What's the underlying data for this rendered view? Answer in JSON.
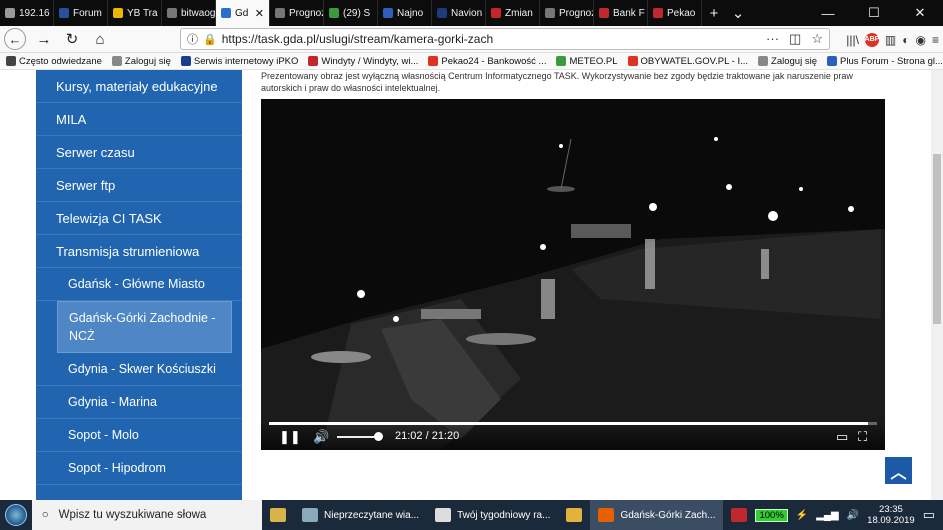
{
  "tabs": [
    {
      "label": "192.16",
      "color": "#999"
    },
    {
      "label": "Forum",
      "color": "#2a4fa0"
    },
    {
      "label": "YB Tra",
      "color": "#e8b900"
    },
    {
      "label": "bitwaogot",
      "color": "#777"
    },
    {
      "label": "Gd",
      "color": "#2a6fc9",
      "active": true
    },
    {
      "label": "Prognoza",
      "color": "#777"
    },
    {
      "label": "(29) S",
      "color": "#3a9b3a"
    },
    {
      "label": "Najno",
      "color": "#2d5fbd"
    },
    {
      "label": "Navion",
      "color": "#1b3b7a"
    },
    {
      "label": "Zmian",
      "color": "#c0282d"
    },
    {
      "label": "Prognoza",
      "color": "#777"
    },
    {
      "label": "Bank F",
      "color": "#c0282d"
    },
    {
      "label": "Pekao",
      "color": "#c0282d"
    }
  ],
  "tab_close": "✕",
  "new_tab": "+",
  "tab_dropdown": "⌄",
  "win": {
    "min": "—",
    "max": "☐",
    "close": "✕"
  },
  "nav": {
    "back": "←",
    "forward": "→",
    "reload": "↻",
    "home": "⌂",
    "url": "https://task.gda.pl/uslugi/stream/kamera-gorki-zach",
    "more": "···",
    "pocket": "◫",
    "star": "☆"
  },
  "right_icons": {
    "library": "|||\\",
    "abp": "ABP",
    "sidebar": "▥",
    "sync": "◐",
    "account": "◉",
    "menu": "≡"
  },
  "bookmarks": [
    {
      "label": "Często odwiedzane",
      "color": "#444"
    },
    {
      "label": "Zaloguj się",
      "color": "#888"
    },
    {
      "label": "Serwis internetowy iPKO",
      "color": "#1a3d8f"
    },
    {
      "label": "Windyty / Windyty, wi...",
      "color": "#c0282d"
    },
    {
      "label": "Pekao24 - Bankowość ...",
      "color": "#d32"
    },
    {
      "label": "METEO.PL",
      "color": "#3a9b3a"
    },
    {
      "label": "OBYWATEL.GOV.PL - I...",
      "color": "#d32"
    },
    {
      "label": "Zaloguj się",
      "color": "#888"
    },
    {
      "label": "Plus Forum - Strona gl...",
      "color": "#2d5fbd"
    }
  ],
  "sidebar": [
    {
      "label": "Kursy, materiały edukacyjne",
      "sub": false
    },
    {
      "label": "MILA",
      "sub": false
    },
    {
      "label": "Serwer czasu",
      "sub": false
    },
    {
      "label": "Serwer ftp",
      "sub": false
    },
    {
      "label": "Telewizja CI TASK",
      "sub": false
    },
    {
      "label": "Transmisja strumieniowa",
      "sub": false
    },
    {
      "label": "Gdańsk - Główne Miasto",
      "sub": true
    },
    {
      "label": "Gdańsk-Górki Zachodnie - NCŻ",
      "sub": true,
      "current": true
    },
    {
      "label": "Gdynia - Skwer Kościuszki",
      "sub": true
    },
    {
      "label": "Gdynia - Marina",
      "sub": true
    },
    {
      "label": "Sopot - Molo",
      "sub": true
    },
    {
      "label": "Sopot - Hipodrom",
      "sub": true
    }
  ],
  "notice": "Prezentowany obraz jest wyłączną własnością Centrum Informatycznego TASK. Wykorzystywanie bez zgody będzie traktowane jak naruszenie praw autorskich i praw do własności intelektualnej.",
  "video": {
    "time": "21:02 / 21:20",
    "progress": 0.985,
    "volume": 0.9,
    "pause": "❚❚",
    "mute": "🔊",
    "pip": "▭",
    "fullscreen": "⛶"
  },
  "scroll_top": "︿",
  "taskbar": {
    "search": "Wpisz tu wyszukiwane słowa",
    "search_icon": "○",
    "tasks": [
      {
        "label": "",
        "color": "#d9b24c"
      },
      {
        "label": "Nieprzeczytane wia...",
        "color": "#8ab"
      },
      {
        "label": "Twój tygodniowy ra...",
        "color": "#ddd"
      },
      {
        "label": "",
        "color": "#e3b23c"
      },
      {
        "label": "Gdańsk-Górki Zach...",
        "color": "#e66000",
        "active": true
      },
      {
        "label": "",
        "color": "#c0282d"
      }
    ],
    "battery": "100%",
    "clock_time": "23:35",
    "clock_date": "18.09.2019"
  }
}
